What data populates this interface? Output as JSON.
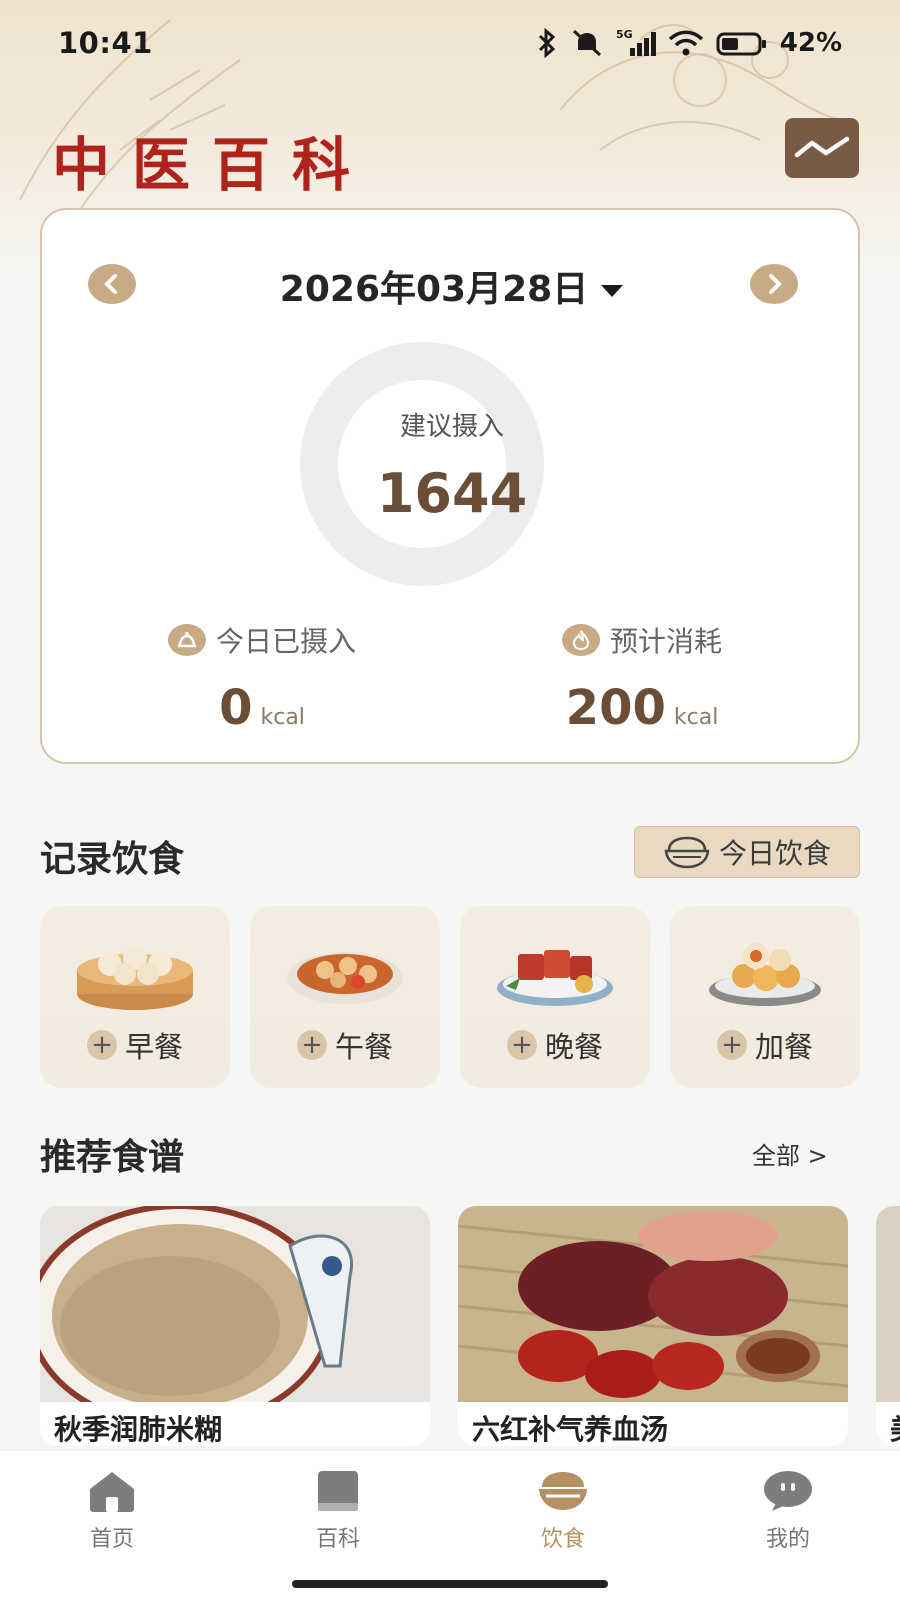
{
  "status_bar": {
    "time": "10:41",
    "network": "5G",
    "battery": "42%"
  },
  "header": {
    "title": "中医百科",
    "trend_icon": "trend-chart-icon"
  },
  "summary": {
    "date": "2026年03月28日",
    "recommended_caption": "建议摄入",
    "recommended_value": "1644",
    "intake_label": "今日已摄入",
    "intake_value": "0",
    "intake_unit": "kcal",
    "burn_label": "预计消耗",
    "burn_value": "200",
    "burn_unit": "kcal"
  },
  "record": {
    "title": "记录饮食",
    "today_button": "今日饮食",
    "meals": [
      {
        "label": "早餐",
        "icon": "steamed-buns-icon"
      },
      {
        "label": "午餐",
        "icon": "braised-dish-icon"
      },
      {
        "label": "晚餐",
        "icon": "braised-pork-icon"
      },
      {
        "label": "加餐",
        "icon": "pastry-icon"
      }
    ]
  },
  "recipes": {
    "title": "推荐食谱",
    "see_all": "全部 >",
    "items": [
      {
        "name": "秋季润肺米糊"
      },
      {
        "name": "六红补气养血汤"
      },
      {
        "name": "美"
      }
    ]
  },
  "tabs": [
    {
      "label": "首页",
      "icon": "home-icon"
    },
    {
      "label": "百科",
      "icon": "book-icon"
    },
    {
      "label": "饮食",
      "icon": "rice-bowl-icon"
    },
    {
      "label": "我的",
      "icon": "profile-icon"
    }
  ],
  "colors": {
    "accent": "#c8aa84",
    "brand_red": "#b0231c",
    "value_brown": "#6b4e37",
    "active_tab": "#b49164"
  }
}
